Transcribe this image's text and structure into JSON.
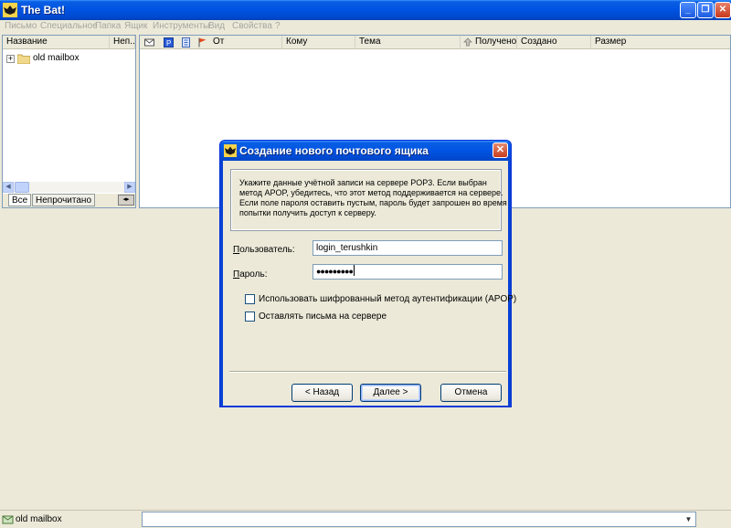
{
  "window": {
    "title": "The Bat!"
  },
  "menu": [
    "Письмо",
    "Специальное",
    "Папка",
    "Ящик",
    "Инструменты",
    "Вид",
    "Свойства",
    "?"
  ],
  "folder_pane": {
    "columns": [
      "Название",
      "Неп..."
    ],
    "tree": [
      {
        "expander": "+",
        "label": "old mailbox"
      }
    ],
    "tabs": [
      "Все",
      "Непрочитано"
    ]
  },
  "message_list": {
    "columns": [
      "От",
      "Кому",
      "Тема",
      "Получено",
      "Создано",
      "Размер"
    ]
  },
  "status": {
    "folder": "old mailbox"
  },
  "dialog": {
    "title": "Создание нового почтового ящика",
    "info_lines": [
      "Укажите данные учётной записи на сервере POP3. Если выбран",
      "метод APOP, убедитесь, что этот метод поддерживается на сервере.",
      "Если поле пароля оставить пустым, пароль будет запрошен во время",
      "попытки получить доступ к серверу."
    ],
    "user_label_underlined": "П",
    "user_label_rest": "ользователь:",
    "user_value": "login_terushkin",
    "password_label_underlined": "П",
    "password_label_rest": "ароль:",
    "password_value": "●●●●●●●●●",
    "checkbox_apop": "Использовать шифрованный метод аутентификации (APOP)",
    "checkbox_leave": "Оставлять письма на сервере",
    "apop_checked": false,
    "leave_checked": false,
    "back_label": "< Назад",
    "next_label": "Далее >",
    "cancel_label": "Отмена"
  },
  "colors": {
    "titlebar": "#0054e3",
    "close": "#c8381c",
    "face": "#ece9d8"
  }
}
